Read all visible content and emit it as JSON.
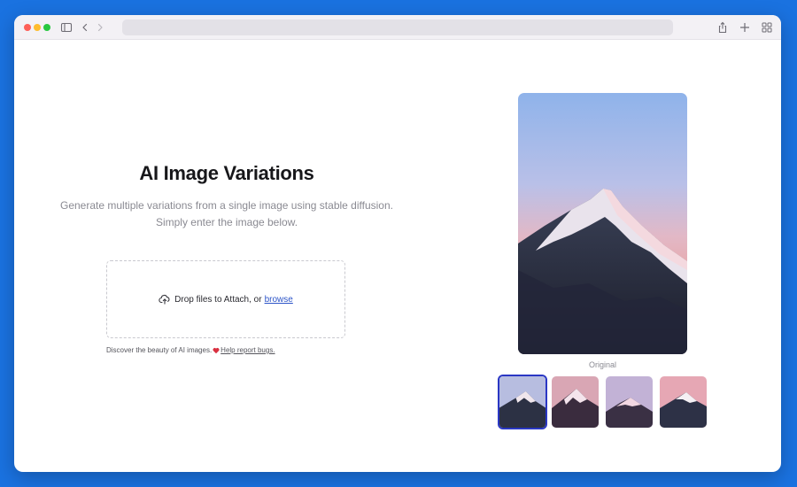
{
  "browser": {
    "address": ""
  },
  "page": {
    "title": "AI Image Variations",
    "subtitle_line1": "Generate multiple variations from a single image using stable diffusion.",
    "subtitle_line2": "Simply enter the image below."
  },
  "dropzone": {
    "text": "Drop files to Attach, or",
    "link": "browse",
    "icon": "cloud-upload-icon"
  },
  "footer": {
    "text": "Discover the beauty of AI images.",
    "link": "Help report bugs.",
    "icon": "heart-icon"
  },
  "preview": {
    "caption": "Original",
    "thumbnail_count": 4,
    "selected_index": 0
  },
  "colors": {
    "background": "#1a72e0",
    "accent": "#2a37c4",
    "link": "#2d55c8"
  }
}
